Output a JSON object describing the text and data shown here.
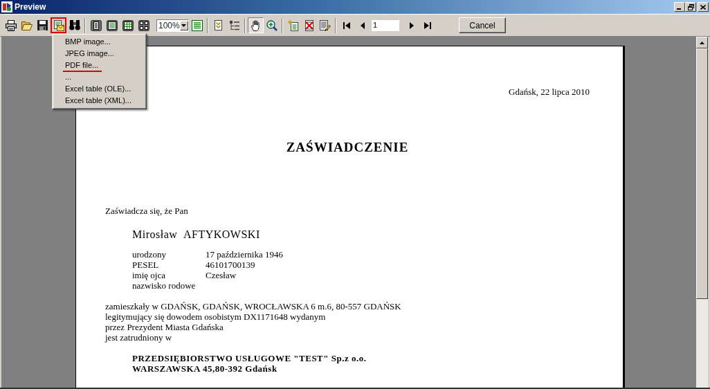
{
  "window": {
    "title": "Preview"
  },
  "toolbar": {
    "export_marked": true,
    "zoom": "100%",
    "pointer_tools": [
      {
        "selected": true
      },
      {
        "selected": false
      }
    ],
    "page_number": "1",
    "cancel_button": "Cancel"
  },
  "export_menu": {
    "items": [
      {
        "label": "BMP image...",
        "marked": false
      },
      {
        "label": "JPEG image...",
        "marked": false
      },
      {
        "label": "PDF file...",
        "marked": true
      },
      {
        "label": "...",
        "marked": false
      },
      {
        "label": "Excel table (OLE)...",
        "marked": false
      },
      {
        "label": "Excel table (XML)...",
        "marked": false
      }
    ]
  },
  "document": {
    "date": "Gdańsk, 22 lipca 2010",
    "title": "ZAŚWIADCZENIE",
    "intro": "Zaświadcza się, że Pan",
    "person": "Mirosław AFTYKOWSKI",
    "details": [
      {
        "label": "urodzony",
        "value": "17 października 1946"
      },
      {
        "label": "PESEL",
        "value": "46101700139"
      },
      {
        "label": "imię ojca",
        "value": "Czesław"
      },
      {
        "label": "nazwisko rodowe"
      }
    ],
    "paragraph_lines": [
      "zamieszkały w GDAŃSK, GDAŃSK, WROCŁAWSKA 6 m.6, 80-557 GDAŃSK",
      "legitymujący się dowodem osobistym DX1171648 wydanym",
      "przez Prezydent Miasta Gdańska",
      "jest zatrudniony w"
    ],
    "employer_lines": [
      "PRZEDSIĘBIORSTWO USŁUGOWE \"TEST\" Sp.z o.o.",
      "WARSZAWSKA 45,80-392 Gdańsk"
    ]
  }
}
